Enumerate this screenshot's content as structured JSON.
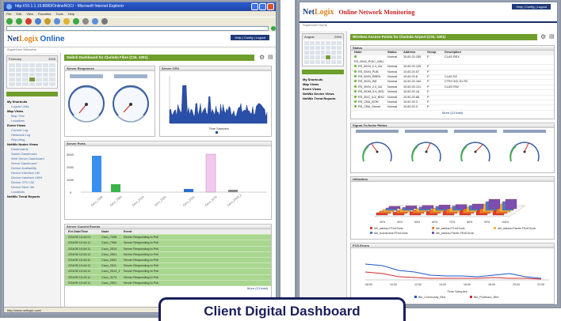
{
  "left_window": {
    "title": "http://10.1.1.15:8080/OnlineNOC/ - Microsoft Internet Explorer",
    "menu": [
      "File",
      "Edit",
      "View",
      "Favorites",
      "Tools",
      "Help"
    ],
    "nav_links": "Help | Config | Logout",
    "breadcrumb": "SuperUser Welcome",
    "logo_prefix": "Net",
    "logo_suffix": "Logix",
    "online": "Online",
    "dashboard_title": "Switch Dashboard for Clarinda Fibre (CSL 1001)",
    "calendar_month": "February",
    "calendar_year": "2005",
    "tree": [
      {
        "label": "My Shortcuts",
        "type": "g"
      },
      {
        "label": "Logout Links",
        "type": "s"
      },
      {
        "label": "Map Views",
        "type": "g"
      },
      {
        "label": "Map Tree",
        "type": "s"
      },
      {
        "label": "Locations",
        "type": "s"
      },
      {
        "label": "Event Views",
        "type": "g"
      },
      {
        "label": "Current Log",
        "type": "s"
      },
      {
        "label": "Historical Log",
        "type": "s"
      },
      {
        "label": "Reporting",
        "type": "s"
      },
      {
        "label": "NetWiz Nodes Views",
        "type": "g"
      },
      {
        "label": "Dashboards",
        "type": "s"
      },
      {
        "label": "Switch Dashboard",
        "type": "s"
      },
      {
        "label": "Web Server Dashboard",
        "type": "s"
      },
      {
        "label": "Server Dashboard",
        "type": "s"
      },
      {
        "label": "Device Availability",
        "type": "s"
      },
      {
        "label": "Device Interface Util",
        "type": "s"
      },
      {
        "label": "Device Interface Util%",
        "type": "s"
      },
      {
        "label": "Device CPU Util",
        "type": "s"
      },
      {
        "label": "Device Mem Util",
        "type": "s"
      },
      {
        "label": "Locations",
        "type": "s"
      },
      {
        "label": "NetWiz Trend Reports",
        "type": "g"
      }
    ],
    "panels": {
      "response": "Server Responses",
      "cpu": "Server CPU",
      "ports": "Server Ports",
      "events": "Server Current Events"
    },
    "event_headers": [
      "Evt Date/Time",
      "Node",
      "Event"
    ],
    "events": [
      [
        "2/24/05 10:44:21",
        "Csco_7206",
        "Server Responding to Poll"
      ],
      [
        "2/24/05 10:44:11",
        "Csco_7500",
        "Server Responding to Poll"
      ],
      [
        "2/24/05 10:44:11",
        "Csco_2514",
        "Server Responding to Poll"
      ],
      [
        "2/24/05 10:44:11",
        "Csco_2501",
        "Server Responding to Poll"
      ],
      [
        "2/24/05 10:44:11",
        "Csco_2501",
        "Server Responding to Poll"
      ],
      [
        "2/24/05 10:44:11",
        "Csco_2511",
        "Server Responding to Poll"
      ],
      [
        "2/24/05 10:44:11",
        "Csco_2514_1",
        "Server Responding to Poll"
      ],
      [
        "2/24/05 10:44:11",
        "Csco_3174",
        "Server Responding to Poll"
      ],
      [
        "2/24/05 10:44:11",
        "Csco_2501",
        "Server Responding to Poll"
      ]
    ],
    "more_link": "More (13 total)",
    "cpu_label": "Time Samples",
    "status_text": "http://www.netlogix.com/"
  },
  "right_window": {
    "logo_prefix": "Net",
    "logo_suffix": "Logix",
    "header_title": "Online Network Monitoring",
    "nav_links": "Help | Config | Logout",
    "breadcrumb": "SuperUser Home",
    "dashboard_title": "Wireless Access Points for Clarinda Airport (CSL 1001)",
    "calendar_month": "August",
    "calendar_year": "2004",
    "tree": [
      {
        "label": "My Shortcuts",
        "type": "g"
      },
      {
        "label": "Map Views",
        "type": "g"
      },
      {
        "label": "Event Views",
        "type": "g"
      },
      {
        "label": "NetWiz Device Views",
        "type": "g"
      },
      {
        "label": "NetWiz Trend Reports",
        "type": "g"
      }
    ],
    "panels": {
      "status": "Status",
      "signal": "Signal-To-Noise Ratios",
      "utilization": "Utilization",
      "fcs": "FCS Errors"
    },
    "status_headers": [
      "Node",
      "Status",
      "Address",
      "Group",
      "Description"
    ],
    "status_rows": [
      [
        "RS_BVM_POIC_ANU",
        "Normal",
        "10.60.20.255",
        "P",
        "CLAS REX"
      ],
      [
        "RS_BVM_2.4_AU",
        "Normal",
        "10.60.20.125",
        "P",
        ""
      ],
      [
        "RS_BVM_PUB",
        "Normal",
        "10.60.20.57",
        "P",
        ""
      ],
      [
        "RS_BVM_RBEN",
        "Normal",
        "10.60.20.8",
        "P",
        "CLAS R2"
      ],
      [
        "RS_BVM_WE",
        "Normal",
        "10.60.20.164",
        "P",
        "CTRY 5GI-S1 R2"
      ],
      [
        "RS_BVM_2.4_AU",
        "Normal",
        "10.60.20.121",
        "P",
        "CLAS R02"
      ],
      [
        "RS_BOM_5.6_BGL",
        "Normal",
        "10.60.20.16",
        "P",
        ""
      ],
      [
        "RS_BVC_5.6_BHU",
        "Normal",
        "10.60.20.88",
        "P",
        ""
      ],
      [
        "RS_CBA_BON",
        "Normal",
        "10.60.20.3",
        "P",
        ""
      ],
      [
        "RS_CBA_Server",
        "Normal",
        "10.60.20.3",
        "P",
        ""
      ]
    ],
    "more_link": "More (13 total)",
    "util_ticks": [
      "30%",
      "40%",
      "50%",
      "60%",
      "70%",
      "80%",
      "90%",
      "100%"
    ],
    "util_legend": [
      "Ath_wakkau FEnt1Sonic",
      "Ath_wakkau FEnt1Sonic",
      "Ath_wakkau Panels FEnt1Sonic",
      "Ath_buchanania FEnt1Sonic",
      "Ath_wakkau Panels FEnt1Sonic"
    ],
    "fcs_xlabel": "Time Samples",
    "fcs_legend": [
      "Bkt_Community_BKd",
      "Bkt_Professor_BKd"
    ],
    "fcs_ticks": [
      "08:00",
      "10:00",
      "12:00",
      "14:00",
      "16:00",
      "18:00",
      "20:00",
      "22:00"
    ]
  },
  "caption": "Client Digital Dashboard"
}
